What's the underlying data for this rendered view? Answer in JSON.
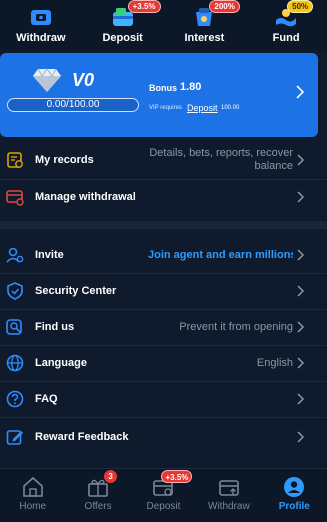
{
  "top_actions": [
    {
      "icon": "withdraw-icon",
      "label": "Withdraw",
      "badge": ""
    },
    {
      "icon": "deposit-icon",
      "label": "Deposit",
      "badge": "+3.5%"
    },
    {
      "icon": "interest-icon",
      "label": "Interest",
      "badge": "200%"
    },
    {
      "icon": "fund-icon",
      "label": "Fund",
      "badge": "50%"
    }
  ],
  "vip": {
    "level": "V0",
    "progress_text": "0.00/100.00",
    "progress_fraction": 0,
    "bonus_label": "Bonus",
    "bonus_value": "1.80",
    "requires_text": "VIP requires",
    "deposit_link": "Deposit",
    "amount": "100.00"
  },
  "menu_primary": [
    {
      "icon": "records-icon",
      "label": "My records",
      "value": "Details, bets, reports, recover balance"
    },
    {
      "icon": "manage-withdrawal-icon",
      "label": "Manage withdrawal",
      "value": ""
    }
  ],
  "menu_secondary": [
    {
      "icon": "invite-icon",
      "label": "Invite",
      "value": "Join agent and earn millions a"
    },
    {
      "icon": "security-shield-icon",
      "label": "Security Center",
      "value": ""
    },
    {
      "icon": "find-us-icon",
      "label": "Find us",
      "value": "Prevent it from opening"
    },
    {
      "icon": "globe-icon",
      "label": "Language",
      "value": "English"
    },
    {
      "icon": "faq-icon",
      "label": "FAQ",
      "value": ""
    },
    {
      "icon": "feedback-icon",
      "label": "Reward Feedback",
      "value": ""
    }
  ],
  "bottom_nav": [
    {
      "icon": "home-icon",
      "label": "Home",
      "badge": "",
      "active": false
    },
    {
      "icon": "offers-gift-icon",
      "label": "Offers",
      "badge": "3",
      "active": false
    },
    {
      "icon": "deposit-nav-icon",
      "label": "Deposit",
      "badge": "+3.5%",
      "active": false
    },
    {
      "icon": "withdraw-nav-icon",
      "label": "Withdraw",
      "badge": "",
      "active": false
    },
    {
      "icon": "profile-icon",
      "label": "Profile",
      "badge": "",
      "active": true
    }
  ],
  "colors": {
    "background": "#0f1b2d",
    "card": "#1d73e6",
    "accent": "#2f9bff",
    "badge_red": "#e53935",
    "badge_gold": "#f5c518",
    "muted_text": "#8b97a8",
    "icon_blue": "#2f8cff",
    "icon_gold": "#e0a100",
    "icon_red": "#e0473f"
  }
}
